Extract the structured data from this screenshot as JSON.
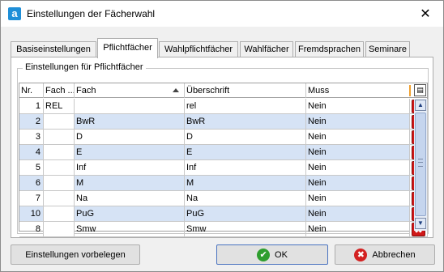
{
  "window": {
    "title": "Einstellungen der Fächerwahl",
    "app_icon_glyph": "a",
    "close_glyph": "✕"
  },
  "tabs": [
    {
      "label": "Basiseinstellungen",
      "active": false
    },
    {
      "label": "Pflichtfächer",
      "active": true
    },
    {
      "label": "Wahlpflichtfächer",
      "active": false
    },
    {
      "label": "Wahlfächer",
      "active": false
    },
    {
      "label": "Fremdsprachen",
      "active": false
    },
    {
      "label": "Seminare",
      "active": false
    }
  ],
  "group": {
    "legend": "Einstellungen für Pflichtfächer"
  },
  "grid": {
    "columns": {
      "nr": "Nr.",
      "fach_kurz": "Fach ...",
      "fach": "Fach",
      "ueberschrift": "Überschrift",
      "muss": "Muss"
    },
    "sort_column": "fach",
    "rows": [
      {
        "nr": "1",
        "fach_kurz": "REL",
        "fach": "",
        "ueberschrift": "rel",
        "muss": "Nein"
      },
      {
        "nr": "2",
        "fach_kurz": "",
        "fach": "BwR",
        "ueberschrift": "BwR",
        "muss": "Nein"
      },
      {
        "nr": "3",
        "fach_kurz": "",
        "fach": "D",
        "ueberschrift": "D",
        "muss": "Nein"
      },
      {
        "nr": "4",
        "fach_kurz": "",
        "fach": "E",
        "ueberschrift": "E",
        "muss": "Nein"
      },
      {
        "nr": "5",
        "fach_kurz": "",
        "fach": "Inf",
        "ueberschrift": "Inf",
        "muss": "Nein"
      },
      {
        "nr": "6",
        "fach_kurz": "",
        "fach": "M",
        "ueberschrift": "M",
        "muss": "Nein"
      },
      {
        "nr": "7",
        "fach_kurz": "",
        "fach": "Na",
        "ueberschrift": "Na",
        "muss": "Nein"
      },
      {
        "nr": "10",
        "fach_kurz": "",
        "fach": "PuG",
        "ueberschrift": "PuG",
        "muss": "Nein"
      },
      {
        "nr": "8",
        "fach_kurz": "",
        "fach": "Smw",
        "ueberschrift": "Smw",
        "muss": "Nein"
      }
    ],
    "delete_glyph": "✖",
    "scroll_up_glyph": "▲",
    "scroll_down_glyph": "▼",
    "column_chooser_glyph": "▤"
  },
  "buttons": {
    "preset": "Einstellungen vorbelegen",
    "ok": "OK",
    "cancel": "Abbrechen",
    "ok_glyph": "✔",
    "cancel_glyph": "✖"
  },
  "colors": {
    "alt_row": "#d6e3f5",
    "delete_red": "#d01818",
    "ok_green": "#2e9e2e",
    "accent_orange": "#f0a030"
  }
}
